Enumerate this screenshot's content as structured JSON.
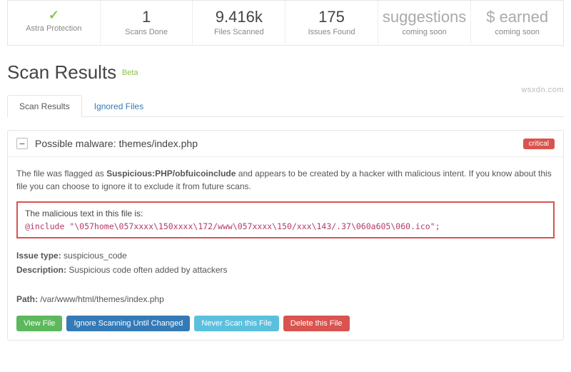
{
  "stats": [
    {
      "value": "✓",
      "label": "Astra Protection",
      "isIcon": true
    },
    {
      "value": "1",
      "label": "Scans Done"
    },
    {
      "value": "9.416k",
      "label": "Files Scanned"
    },
    {
      "value": "175",
      "label": "Issues Found"
    },
    {
      "value": "suggestions",
      "label": "coming soon",
      "muted": true
    },
    {
      "value": "$ earned",
      "label": "coming soon",
      "muted": true
    }
  ],
  "page_title": "Scan Results",
  "beta_tag": "Beta",
  "tabs": {
    "results": "Scan Results",
    "ignored": "Ignored Files"
  },
  "issue": {
    "header": "Possible malware: themes/index.php",
    "badge": "critical",
    "desc_pre": "The file was flagged as ",
    "desc_flag": "Suspicious:PHP/obfuicoinclude",
    "desc_post": " and appears to be created by a hacker with malicious intent. If you know about this file you can choose to ignore it to exclude it from future scans.",
    "code_label": "The malicious text in this file is:",
    "code": "@include \"\\057home\\057xxxx\\150xxxx\\172/www\\057xxxx\\150/xxx\\143/.37\\060a605\\060.ico\";",
    "issue_type_label": "Issue type:",
    "issue_type_value": " suspicious_code",
    "description_label": "Description:",
    "description_value": " Suspicious code often added by attackers",
    "path_label": "Path:",
    "path_value": " /var/www/html/themes/index.php",
    "buttons": {
      "view": "View File",
      "ignore": "Ignore Scanning Until Changed",
      "never": "Never Scan this File",
      "delete": "Delete this File"
    }
  },
  "watermark": "wsxdn.com"
}
